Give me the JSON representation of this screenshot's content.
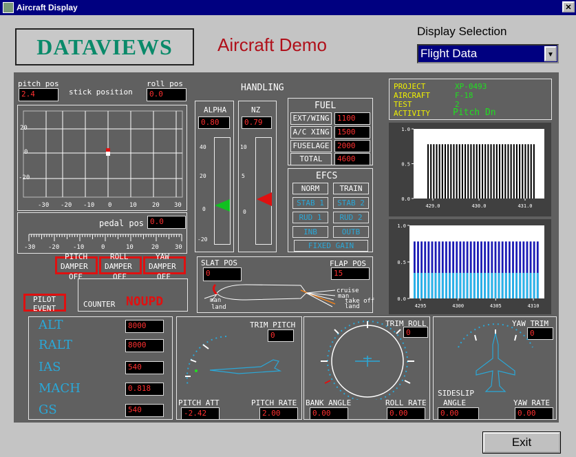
{
  "window": {
    "title": "Aircraft Display",
    "close": "✕"
  },
  "logo": "DATAVIEWS",
  "demo_title": "Aircraft Demo",
  "display_selection": {
    "label": "Display Selection",
    "value": "Flight Data",
    "arrow": "▼"
  },
  "stick": {
    "pitch_pos_label": "pitch pos",
    "pitch_pos": "2.4",
    "stick_position_label": "stick position",
    "roll_pos_label": "roll pos",
    "roll_pos": "0.0",
    "y_ticks": [
      "20",
      "0",
      "-20"
    ],
    "x_ticks": [
      "-30",
      "-20",
      "-10",
      "0",
      "10",
      "20",
      "30"
    ],
    "pedal_pos_label": "pedal pos",
    "pedal_pos": "0.0",
    "pedal_ticks": [
      "-30",
      "-20",
      "-10",
      "0",
      "10",
      "20",
      "30"
    ]
  },
  "handling": {
    "title": "HANDLING",
    "alpha_label": "ALPHA",
    "alpha": "0.80",
    "nz_label": "NZ",
    "nz": "0.79",
    "alpha_ticks": [
      "40",
      "20",
      "0",
      "-20"
    ],
    "nz_ticks": [
      "10",
      "5",
      "0"
    ]
  },
  "fuel": {
    "title": "FUEL",
    "rows": [
      {
        "label": "EXT/WING",
        "value": "1100"
      },
      {
        "label": "A/C XING",
        "value": "1500"
      },
      {
        "label": "FUSELAGE",
        "value": "2000"
      },
      {
        "label": "TOTAL",
        "value": "4600"
      }
    ]
  },
  "efcs": {
    "title": "EFCS",
    "norm": "NORM",
    "train": "TRAIN",
    "stab1": "STAB 1",
    "stab2": "STAB 2",
    "rud1": "RUD 1",
    "rud2": "RUD 2",
    "inb": "INB",
    "outb": "OUTB",
    "fixed_gain": "FIXED GAIN"
  },
  "project": {
    "project_label": "PROJECT",
    "project": "XP-0493",
    "aircraft_label": "AIRCRAFT",
    "aircraft": "F-18",
    "test_label": "TEST",
    "test": "2",
    "activity_label": "ACTIVITY",
    "activity": "Pitch Dn"
  },
  "chart_data": [
    {
      "type": "bar",
      "y_ticks": [
        "1.0",
        "0.5",
        "0.0"
      ],
      "x_ticks": [
        "429.0",
        "430.0",
        "431.0"
      ],
      "ylim": [
        0,
        1.0
      ],
      "series": [
        {
          "values": [
            0.78,
            0.78,
            0.78,
            0.78,
            0.78,
            0.78,
            0.78,
            0.78,
            0.78,
            0.78,
            0.78,
            0.78,
            0.78,
            0.78,
            0.78,
            0.78,
            0.78,
            0.78,
            0.78,
            0.78,
            0.78,
            0.78,
            0.78,
            0.78,
            0.78,
            0.78,
            0.78,
            0.78,
            0.78,
            0.78,
            0.78,
            0.78,
            0.78,
            0.78,
            0.78,
            0.78,
            0.78,
            0.78
          ]
        }
      ]
    },
    {
      "type": "bar",
      "y_ticks": [
        "1.0",
        "0.5",
        "0.0"
      ],
      "x_ticks": [
        "4295",
        "4300",
        "4305",
        "4310"
      ],
      "ylim": [
        0,
        1.0
      ],
      "series": [
        {
          "values": [
            0.78,
            0.78,
            0.78,
            0.78,
            0.78,
            0.78,
            0.78,
            0.78,
            0.78,
            0.78,
            0.78,
            0.78,
            0.78,
            0.78,
            0.78,
            0.78,
            0.78,
            0.78,
            0.78,
            0.78,
            0.78,
            0.78,
            0.78,
            0.78,
            0.78,
            0.78,
            0.78,
            0.78,
            0.78,
            0.78,
            0.78,
            0.78,
            0.78,
            0.78,
            0.78,
            0.78
          ],
          "color": "#1a1ab4"
        },
        {
          "values": [
            0.35,
            0.35,
            0.35,
            0.35,
            0.35,
            0.35,
            0.35,
            0.35,
            0.35,
            0.35,
            0.35,
            0.35,
            0.35,
            0.35,
            0.35,
            0.35,
            0.35,
            0.35,
            0.35,
            0.35,
            0.35,
            0.35,
            0.35,
            0.35,
            0.35,
            0.35,
            0.35,
            0.35,
            0.35,
            0.35,
            0.35,
            0.35,
            0.35,
            0.35,
            0.35,
            0.35
          ],
          "color": "#28b4e8"
        }
      ]
    }
  ],
  "dampers": {
    "pitch": [
      "PITCH",
      "DAMPER",
      "OFF"
    ],
    "roll": [
      "ROLL",
      "DAMPER",
      "OFF"
    ],
    "yaw": [
      "YAW",
      "DAMPER",
      "OFF"
    ]
  },
  "pilot_event": [
    "PILOT",
    "EVENT"
  ],
  "counter": {
    "label": "COUNTER",
    "value": "NOUPD"
  },
  "flaps": {
    "slat_pos_label": "SLAT POS",
    "slat_pos": "0",
    "flap_pos_label": "FLAP POS",
    "flap_pos": "15",
    "man": "man",
    "land": "land",
    "cruise": "cruise",
    "man2": "man",
    "take_off": "take off",
    "land2": "land"
  },
  "flight": [
    {
      "label": "ALT",
      "value": "8000"
    },
    {
      "label": "RALT",
      "value": "8000"
    },
    {
      "label": "IAS",
      "value": "540"
    },
    {
      "label": "MACH",
      "value": "0.818"
    },
    {
      "label": "GS",
      "value": "540"
    }
  ],
  "pitch_att": {
    "trim_label": "TRIM PITCH",
    "trim": "0",
    "att_label": "PITCH ATT",
    "att": "-2.42",
    "rate_label": "PITCH RATE",
    "rate": "2.00"
  },
  "roll": {
    "trim_label": "TRIM ROLL",
    "trim": "0",
    "bank_label": "BANK ANGLE",
    "bank": "0.00",
    "rate_label": "ROLL RATE",
    "rate": "0.00"
  },
  "yaw": {
    "trim_label": "YAW TRIM",
    "trim": "0",
    "sideslip_label1": "SIDESLIP",
    "sideslip_label2": "ANGLE",
    "sideslip": "0.00",
    "rate_label": "YAW RATE",
    "rate": "0.00"
  },
  "exit": "Exit"
}
